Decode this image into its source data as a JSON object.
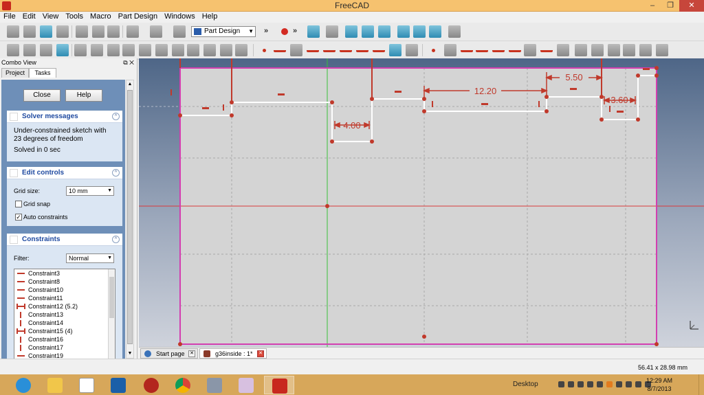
{
  "window": {
    "title": "FreeCAD",
    "minimize": "‒",
    "maximize": "❐",
    "close": "✕"
  },
  "menu": [
    "File",
    "Edit",
    "View",
    "Tools",
    "Macro",
    "Part Design",
    "Windows",
    "Help"
  ],
  "toolbar": {
    "workbench": "Part Design",
    "more": "»"
  },
  "combo": {
    "title": "Combo View",
    "title_controls": "⧉ ✕",
    "tabs": [
      "Project",
      "Tasks"
    ],
    "close_button": "Close",
    "help_button": "Help",
    "solver": {
      "header": "Solver messages",
      "message": "Under-constrained sketch with 23 degrees of freedom",
      "time": "Solved in 0 sec"
    },
    "edit_controls": {
      "header": "Edit controls",
      "grid_size_label": "Grid size:",
      "grid_size_value": "10 mm",
      "grid_snap_label": "Grid snap",
      "grid_snap_checked": false,
      "auto_constraints_label": "Auto constraints",
      "auto_constraints_checked": true
    },
    "constraints": {
      "header": "Constraints",
      "filter_label": "Filter:",
      "filter_value": "Normal",
      "items": [
        {
          "label": "Constraint3",
          "kind": "horizontal"
        },
        {
          "label": "Constraint8",
          "kind": "horizontal"
        },
        {
          "label": "Constraint10",
          "kind": "horizontal"
        },
        {
          "label": "Constraint11",
          "kind": "horizontal"
        },
        {
          "label": "Constraint12 (5.2)",
          "kind": "distance"
        },
        {
          "label": "Constraint13",
          "kind": "vertical"
        },
        {
          "label": "Constraint14",
          "kind": "vertical"
        },
        {
          "label": "Constraint15 (4)",
          "kind": "distance"
        },
        {
          "label": "Constraint16",
          "kind": "vertical"
        },
        {
          "label": "Constraint17",
          "kind": "vertical"
        },
        {
          "label": "Constraint19",
          "kind": "horizontal"
        }
      ]
    }
  },
  "sketch": {
    "dimensions": [
      "4.00",
      "12.20",
      "5.50",
      "3.60"
    ]
  },
  "doc_tabs": [
    {
      "label": "Start page",
      "active": false
    },
    {
      "label": "g36inside : 1*",
      "active": true
    }
  ],
  "status": {
    "coords": "56.41 x 28.98 mm"
  },
  "taskbar": {
    "apps": [
      "internet-explorer",
      "file-explorer",
      "amazon",
      "settings",
      "power",
      "chrome",
      "calculator",
      "paint",
      "freecad"
    ],
    "desktop_label": "Desktop",
    "time": "12:29 AM",
    "date": "8/7/2013"
  },
  "colors": {
    "titlebar": "#f6c26f",
    "sketch_line": "#ffffff",
    "constraint": "#c0392b",
    "sketch_border": "#d33fb0",
    "axis_x": "#d93a3a",
    "axis_y": "#39c039"
  }
}
